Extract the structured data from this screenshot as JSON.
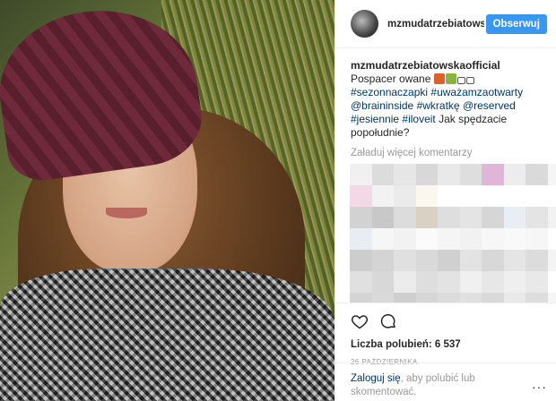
{
  "post": {
    "username": "mzmudatrzebiatowskaofficial",
    "header_username": "mzmudatrzebiatows",
    "follow_label": "Obserwuj",
    "caption_text": "Pospacer owane",
    "caption_rest": "Jak spędzacie popołudnie?",
    "hashtags": [
      "#sezonnaczapki",
      "#uważamzaotwarty",
      "@braininside",
      "#wkratkę",
      "@reserved",
      "#jesiennie",
      "#iloveit"
    ],
    "load_more": "Załaduj więcej komentarzy",
    "likes_label": "Liczba polubień: 6 537",
    "date": "26 PAŹDZIERNIKA",
    "login_link": "Zaloguj się",
    "login_rest": ", aby polubić lub skomentować.",
    "more_icon": "···"
  },
  "colors": {
    "accent": "#3897f0",
    "link": "#003569",
    "muted": "#999999"
  },
  "icons": {
    "like": "heart-icon",
    "comment": "comment-icon",
    "more": "more-options-icon"
  },
  "blurred_comments_palette": [
    "#f0f0f0",
    "#dcdcdc",
    "#e6e6e6",
    "#d8d8d8",
    "#e9e9e9",
    "#dedede",
    "#e0b5d8",
    "#ececec",
    "#dadada",
    "#f5f5f5",
    "#f3d9e6",
    "#f2f2f2",
    "#ebebeb",
    "#fbf6ee",
    "#ffffff",
    "#ffffff",
    "#ffffff",
    "#ffffff",
    "#ffffff",
    "#ffffff",
    "#d2d2d2",
    "#c8c8c8",
    "#dcdcdc",
    "#d9d2c2",
    "#dedede",
    "#e4e4e4",
    "#d6d6d6",
    "#e8eef3",
    "#e4e4e4",
    "#f2f2f2",
    "#e8edf4",
    "#f6f6f6",
    "#f2f2f2",
    "#fafafa",
    "#f5f5f5",
    "#f1f1f1",
    "#f7f7f7",
    "#f9f9f9",
    "#f6f6f6",
    "#ffffff",
    "#cdcdcd",
    "#d4d4d4",
    "#e0e0e0",
    "#d9d9d9",
    "#d0d0d0",
    "#e3e3e3",
    "#d8d8d8",
    "#e5e5e5",
    "#dcdcdc",
    "#f4f4f4",
    "#e0e0e0",
    "#d8d8d8",
    "#ebebeb",
    "#dedede",
    "#e3e3e3",
    "#f0f0f0",
    "#e7e7e7",
    "#efefef",
    "#e9e9e9",
    "#ffffff",
    "#d4d4d4",
    "#dadada",
    "#cfcfcf",
    "#d6d6d6",
    "#dcdcdc",
    "#e0e0e0",
    "#d9d9d9",
    "#e9e9e9",
    "#dddddd",
    "#f5f5f5",
    "#cfcfcf",
    "#dcdcdc",
    "#e6dfc9",
    "#bfd1e4",
    "#ffffff",
    "#ffffff",
    "#ffffff",
    "#ffffff",
    "#ffffff",
    "#ffffff"
  ]
}
